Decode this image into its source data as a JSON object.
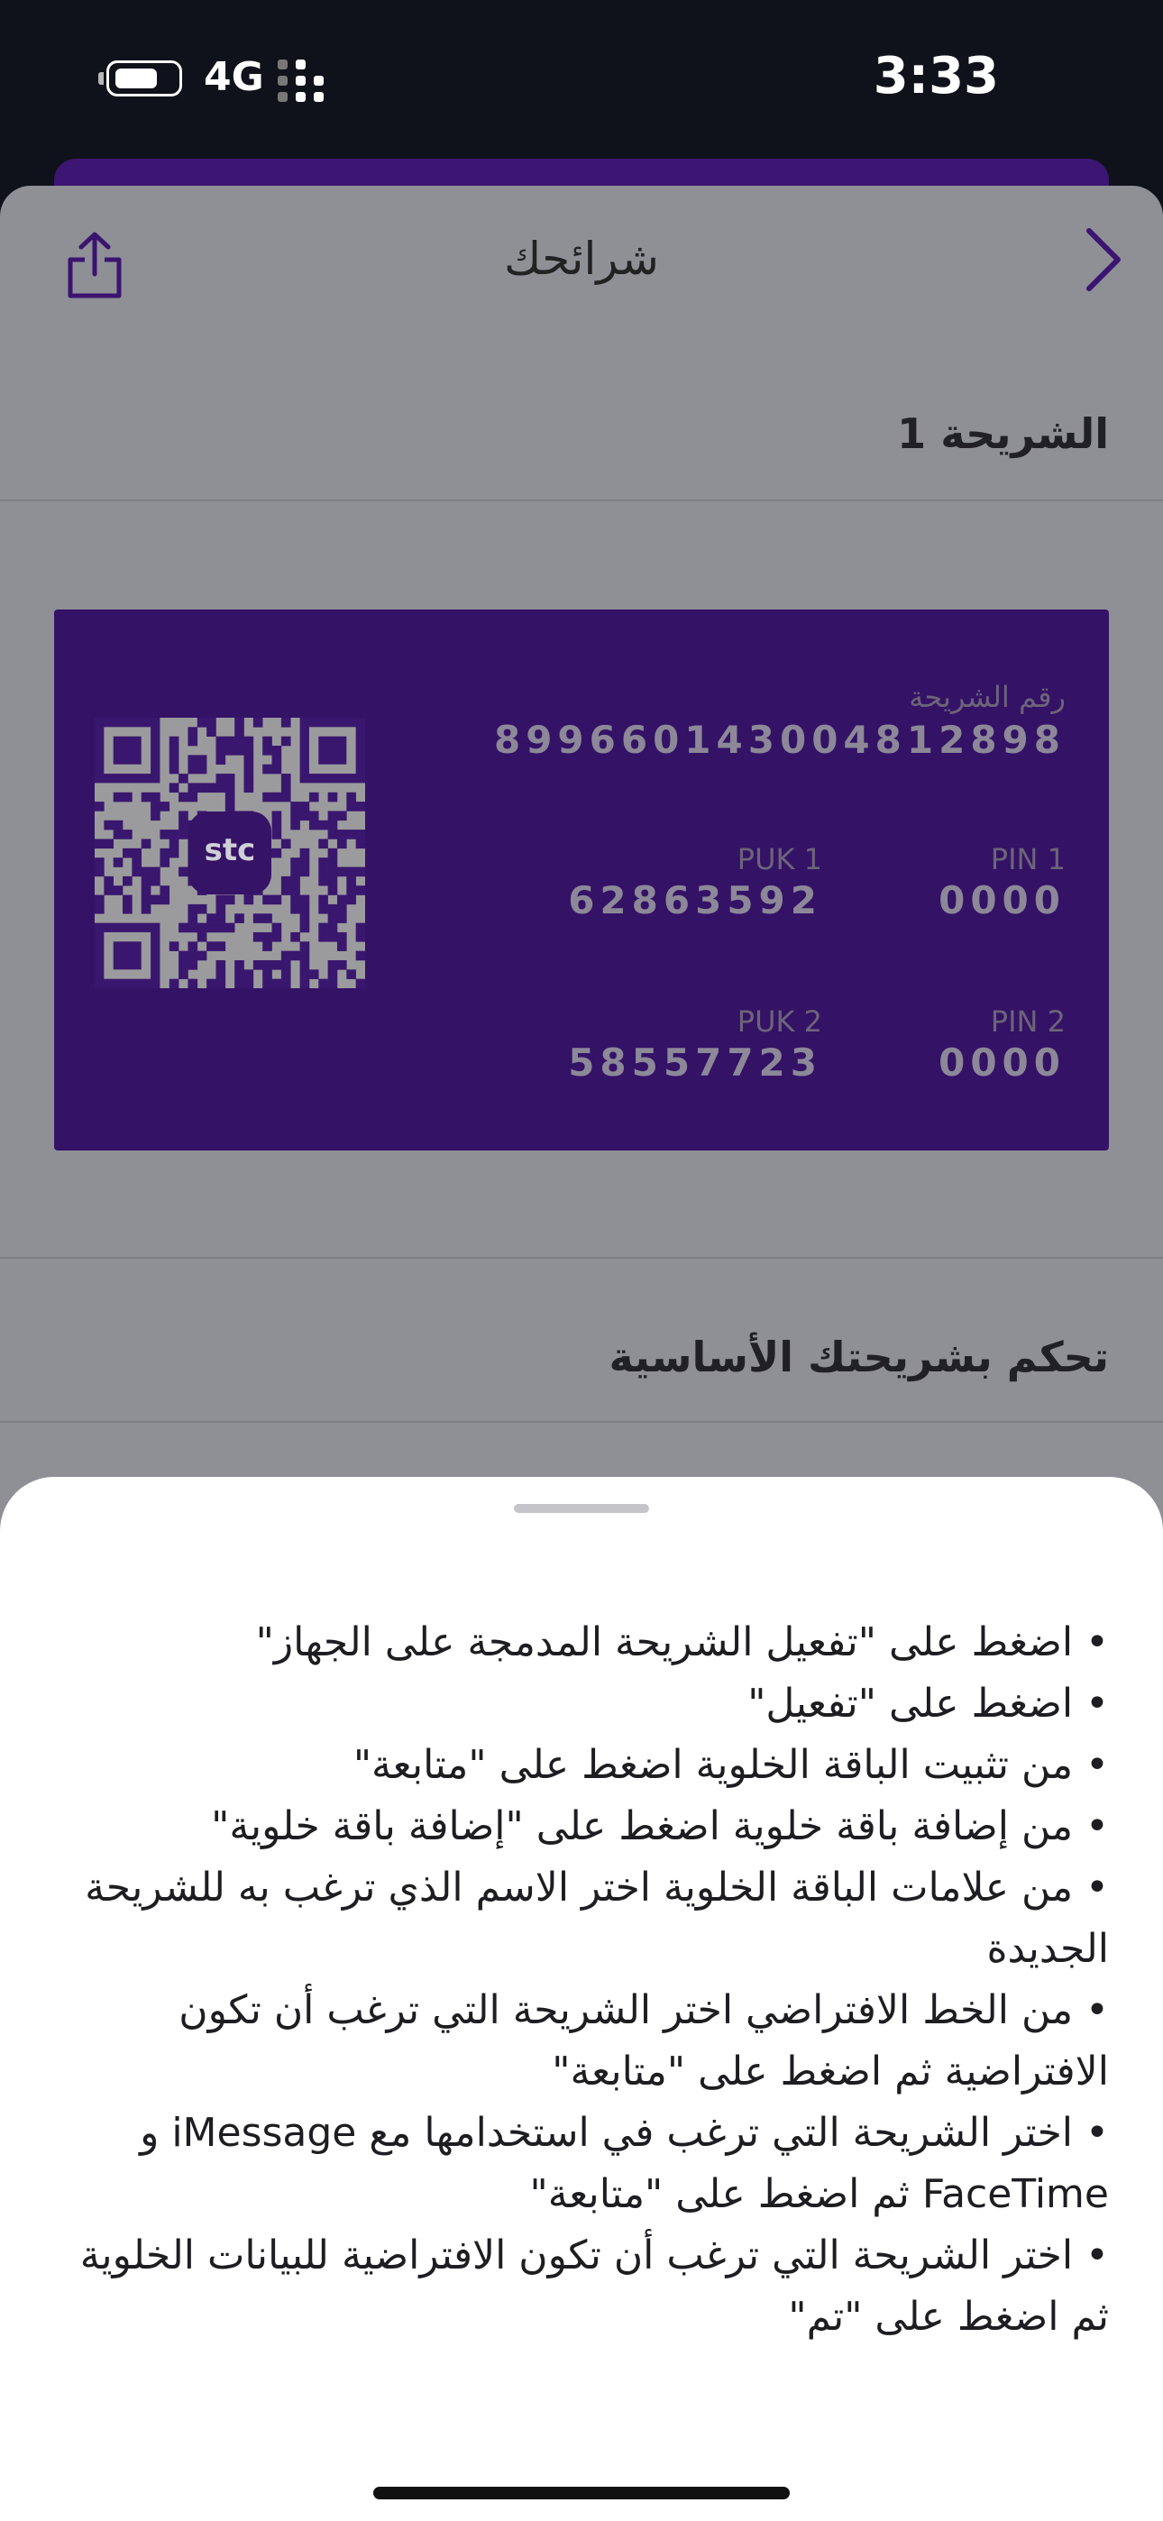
{
  "status_bar": {
    "time": "3:33",
    "network": "4G"
  },
  "nav": {
    "title": "شرائحك",
    "share_icon": "share-icon",
    "back_icon": "chevron-right-icon"
  },
  "sim_section": {
    "title": "الشريحة 1"
  },
  "sim_card": {
    "number_label": "رقم الشريحة",
    "number": "89966014300481289​8",
    "pin1_label": "PIN 1",
    "pin1": "0000",
    "puk1_label": "PUK 1",
    "puk1": "62863592",
    "pin2_label": "PIN 2",
    "pin2": "0000",
    "puk2_label": "PUK 2",
    "puk2": "58557723",
    "qr_logo": "stc",
    "card_color": "#341266"
  },
  "control_section": {
    "title": "تحكم بشريحتك الأساسية"
  },
  "instructions": [
    "اضغط على \"تفعيل الشريحة المدمجة على الجهاز\"",
    "اضغط على \"تفعيل\"",
    "من تثبيت الباقة الخلوية اضغط على \"متابعة\"",
    "من إضافة باقة خلوية اضغط على \"إضافة باقة خلوية\"",
    "من علامات الباقة الخلوية اختر الاسم الذي ترغب به للشريحة الجديدة",
    "من الخط الافتراضي اختر الشريحة التي ترغب أن تكون الافتراضية ثم اضغط على \"متابعة\"",
    "اختر الشريحة التي ترغب في استخدامها مع iMessage و FaceTime ثم اضغط على \"متابعة\"",
    "اختر الشريحة التي ترغب أن تكون الافتراضية للبيانات الخلوية ثم اضغط على \"تم\""
  ]
}
